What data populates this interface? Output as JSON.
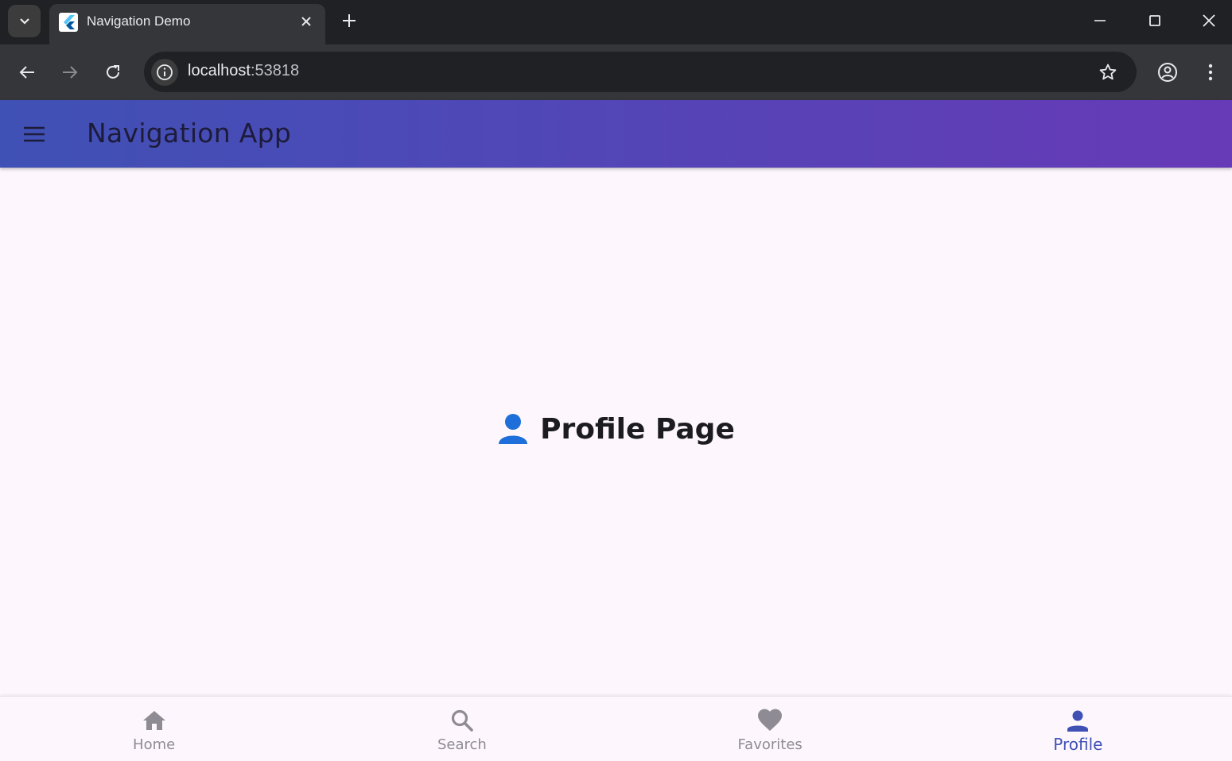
{
  "browser": {
    "tab_title": "Navigation Demo",
    "url_host": "localhost",
    "url_port": ":53818"
  },
  "app": {
    "title": "Navigation App",
    "page_heading": "Profile Page",
    "accent_color": "#3f51b5",
    "gradient_start": "#3f51b5",
    "gradient_end": "#673ab7"
  },
  "bottom_nav": {
    "items": [
      {
        "label": "Home",
        "icon": "home-icon",
        "active": false
      },
      {
        "label": "Search",
        "icon": "search-icon",
        "active": false
      },
      {
        "label": "Favorites",
        "icon": "heart-icon",
        "active": false
      },
      {
        "label": "Profile",
        "icon": "person-icon",
        "active": true
      }
    ]
  }
}
